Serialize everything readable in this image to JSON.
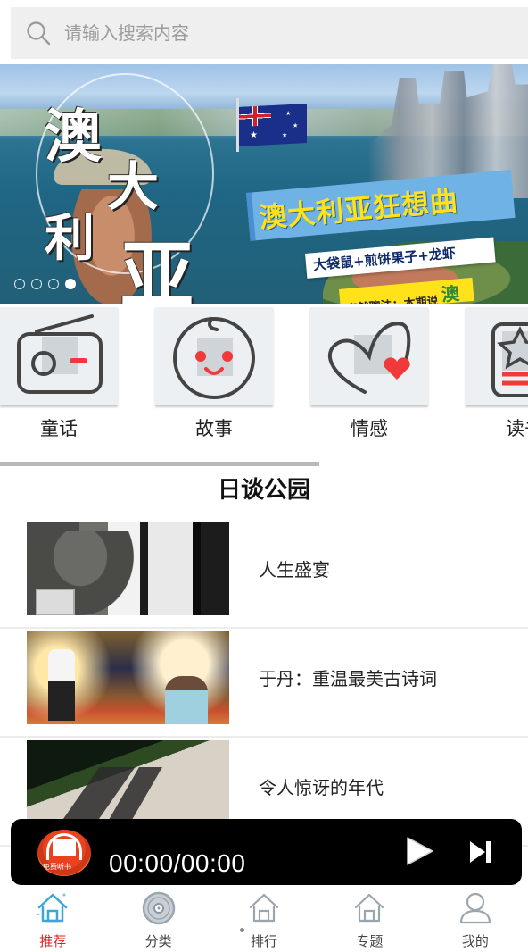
{
  "search": {
    "placeholder": "请输入搜索内容",
    "icon": "search-icon"
  },
  "banner": {
    "title_chars": [
      "澳",
      "大",
      "利",
      "亚"
    ],
    "slogan": "澳大利亚狂想曲",
    "subtitle": "大袋鼠+煎饼果子+龙虾",
    "tagline": "字然聊法：本期说",
    "tagline_highlight": "澳",
    "slide_count": 4,
    "active_slide": 4
  },
  "categories": [
    {
      "label": "童话",
      "icon": "radio-icon"
    },
    {
      "label": "故事",
      "icon": "baby-face-icon"
    },
    {
      "label": "情感",
      "icon": "heart-icon"
    },
    {
      "label": "读书",
      "icon": "star-card-icon"
    }
  ],
  "section": {
    "title": "日谈公园"
  },
  "list": [
    {
      "title": "人生盛宴"
    },
    {
      "title": "于丹：重温最美古诗词"
    },
    {
      "title": "令人惊讶的年代"
    }
  ],
  "player": {
    "cover_caption": "免费听书",
    "time": "00:00/00:00",
    "play_icon": "play-icon",
    "next_icon": "skip-next-icon"
  },
  "tabbar": {
    "active_index": 0,
    "active_color": "#e02020",
    "items": [
      {
        "label": "推荐",
        "icon": "home-icon"
      },
      {
        "label": "分类",
        "icon": "disc-icon"
      },
      {
        "label": "排行",
        "icon": "home-icon"
      },
      {
        "label": "专题",
        "icon": "home-icon"
      },
      {
        "label": "我的",
        "icon": "user-icon"
      }
    ]
  }
}
